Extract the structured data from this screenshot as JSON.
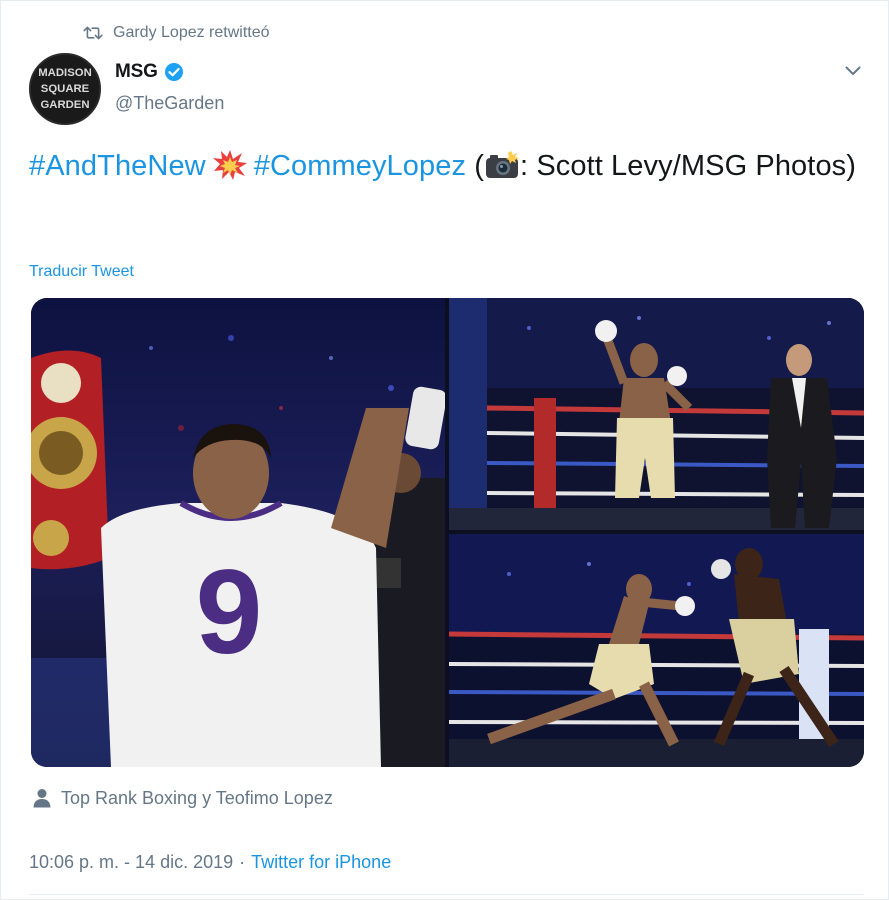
{
  "retweet_context": {
    "text": "Gardy Lopez retwitteó",
    "icon": "retweet-icon"
  },
  "author": {
    "display_name": "MSG",
    "handle": "@TheGarden",
    "verified": true,
    "avatar_icon": "madison-square-garden-logo",
    "avatar_text": [
      "MADISON",
      "SQUARE",
      "GARDEN"
    ]
  },
  "menu": {
    "icon": "chevron-down-icon"
  },
  "tweet": {
    "hashtag_1": "#AndTheNew",
    "emoji_1": "collision-emoji",
    "hashtag_2": "#CommeyLopez",
    "open_paren": " (",
    "emoji_2": "camera-with-flash-emoji",
    "credit": ": Scott Levy/MSG Photos)"
  },
  "translate_label": "Traducir Tweet",
  "media": {
    "photos": [
      {
        "name": "photo-boxer-with-belt"
      },
      {
        "name": "photo-ring-celebration"
      },
      {
        "name": "photo-knockdown-punch"
      }
    ]
  },
  "tagged": {
    "icon": "person-icon",
    "text": "Top Rank Boxing y Teofimo Lopez"
  },
  "meta": {
    "time": "10:06 p. m. - 14 dic. 2019",
    "separator": "·",
    "source": "Twitter for iPhone"
  },
  "colors": {
    "link": "#1b95e0",
    "secondary_text": "#657786",
    "primary_text": "#14171a",
    "verified": "#1da1f2"
  }
}
